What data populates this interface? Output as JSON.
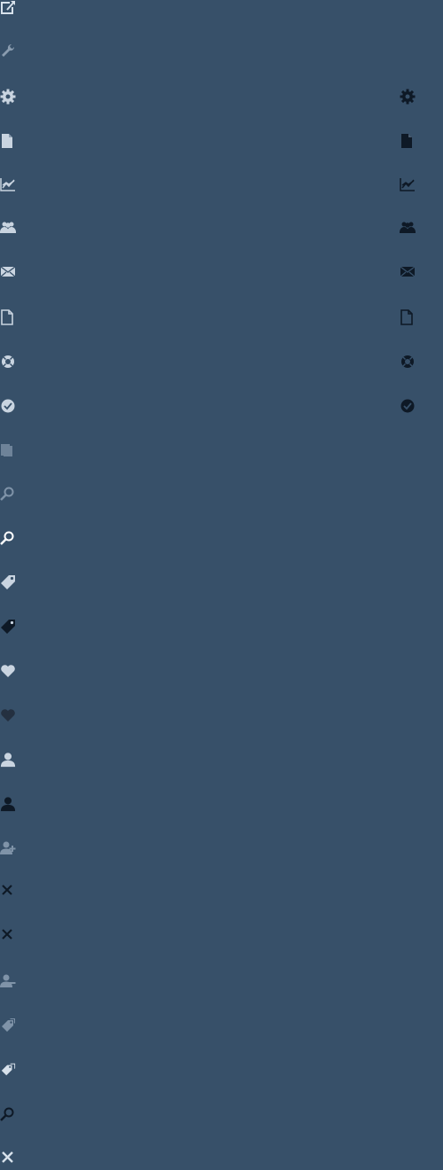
{
  "colors": {
    "background": "#375069",
    "icon_light": "#C9D4E0",
    "icon_muted": "#7F93A8",
    "icon_dark": "#0E1926",
    "icon_white": "#FFFFFF"
  },
  "sprites": {
    "left": [
      {
        "name": "external-link-icon",
        "color": "#D7E1EB"
      },
      {
        "name": "wrench-icon",
        "color": "#8A9CAF"
      },
      {
        "name": "gear-icon",
        "color": "#C9D4E0"
      },
      {
        "name": "document-icon",
        "color": "#C9D4E0"
      },
      {
        "name": "chart-icon",
        "color": "#C9D4E0"
      },
      {
        "name": "users-icon",
        "color": "#C9D4E0"
      },
      {
        "name": "mail-icon",
        "color": "#C9D4E0"
      },
      {
        "name": "document-outline-icon",
        "color": "#C9D4E0"
      },
      {
        "name": "lifebuoy-icon",
        "color": "#C9D4E0"
      },
      {
        "name": "clock-check-icon",
        "color": "#C9D4E0"
      },
      {
        "name": "pages-icon",
        "color": "#6E8399"
      },
      {
        "name": "search-light-icon",
        "color": "#7F93A8"
      },
      {
        "name": "search-icon",
        "color": "#FFFFFF"
      },
      {
        "name": "tag-icon",
        "color": "#C9D4E0"
      },
      {
        "name": "tag-dark-icon",
        "color": "#0E1926"
      },
      {
        "name": "heart-icon",
        "color": "#C9D4E0"
      },
      {
        "name": "heart-dark-icon",
        "color": "#243040"
      },
      {
        "name": "user-icon",
        "color": "#C9D4E0"
      },
      {
        "name": "user-dark-icon",
        "color": "#0E1926"
      },
      {
        "name": "user-add-icon",
        "color": "#7F93A8"
      },
      {
        "name": "close-dark-icon",
        "color": "#0E1926"
      },
      {
        "name": "close-dark-icon",
        "color": "#0E1926"
      },
      {
        "name": "user-remove-icon",
        "color": "#7F93A8"
      },
      {
        "name": "tags-light-icon",
        "color": "#7F93A8"
      },
      {
        "name": "tags-icon",
        "color": "#D7E1EB"
      },
      {
        "name": "search-dark-icon",
        "color": "#0E1926"
      },
      {
        "name": "close-icon",
        "color": "#D7E1EB"
      }
    ],
    "right": [
      {
        "name": "gear-dark-icon",
        "color": "#0E1926"
      },
      {
        "name": "document-dark-icon",
        "color": "#0E1926"
      },
      {
        "name": "chart-dark-icon",
        "color": "#0E1926"
      },
      {
        "name": "users-dark-icon",
        "color": "#0E1926"
      },
      {
        "name": "mail-dark-icon",
        "color": "#0E1926"
      },
      {
        "name": "document-outline-dark-icon",
        "color": "#0E1926"
      },
      {
        "name": "lifebuoy-dark-icon",
        "color": "#0E1926"
      },
      {
        "name": "clock-check-dark-icon",
        "color": "#0E1926"
      }
    ]
  }
}
